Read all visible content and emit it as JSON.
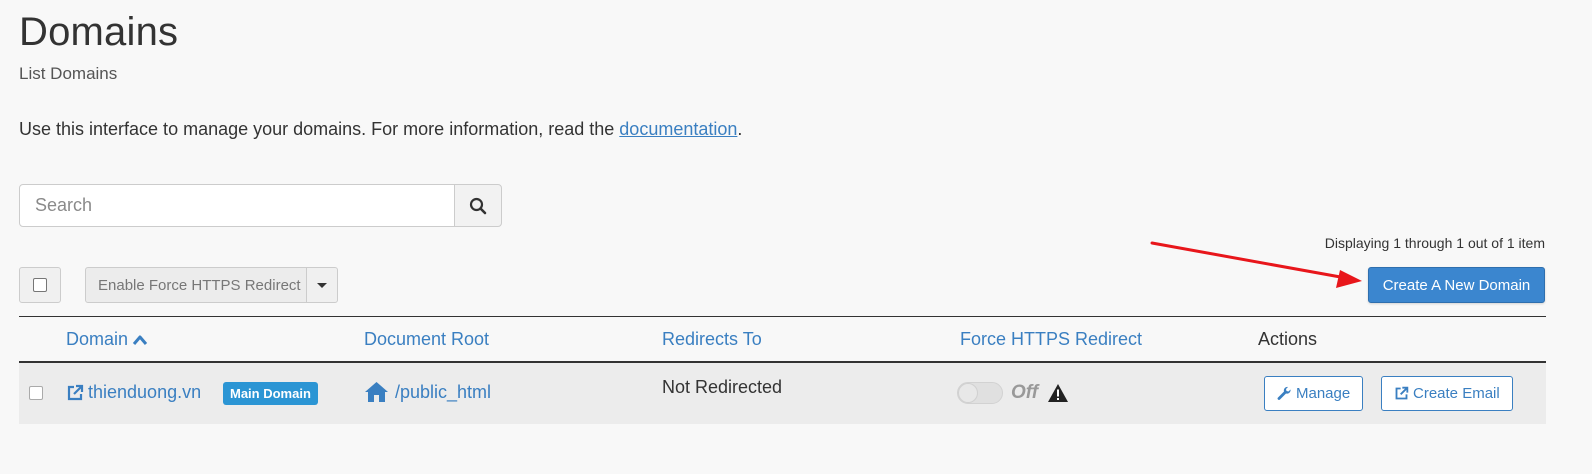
{
  "header": {
    "title": "Domains",
    "subtitle": "List Domains"
  },
  "intro": {
    "text": "Use this interface to manage your domains. For more information, read the ",
    "link": "documentation",
    "suffix": "."
  },
  "search": {
    "placeholder": "Search",
    "icon": "search-icon"
  },
  "pagination": {
    "info": "Displaying 1 through 1 out of 1 item"
  },
  "toolbar": {
    "bulk_action_label": "Enable Force HTTPS Redirect",
    "create_label": "Create A New Domain"
  },
  "table": {
    "columns": {
      "domain": "Domain",
      "doc_root": "Document Root",
      "redirects": "Redirects To",
      "https": "Force HTTPS Redirect",
      "actions": "Actions"
    },
    "rows": [
      {
        "domain": "thienduong.vn",
        "badge": "Main Domain",
        "doc_root": "/public_html",
        "redirects": "Not Redirected",
        "https_state": "Off",
        "manage_label": "Manage",
        "create_email_label": "Create Email"
      }
    ]
  },
  "colors": {
    "accent": "#3a7fc1",
    "primary_button": "#3b86cf",
    "badge": "#2b95d4",
    "annotation_arrow": "#e8161b"
  }
}
